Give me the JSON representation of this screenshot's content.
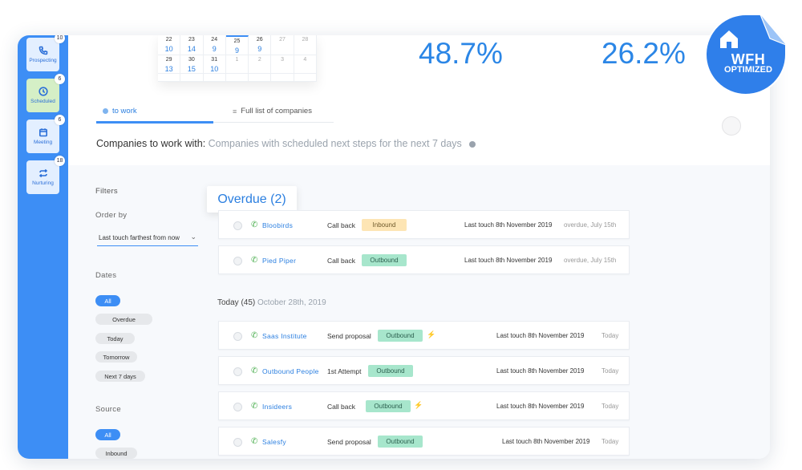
{
  "sidebar": {
    "items": [
      {
        "label": "Prospecting",
        "count": "10",
        "icon": "phone-icon"
      },
      {
        "label": "Scheduled",
        "count": "6",
        "icon": "clock-icon"
      },
      {
        "label": "Meeting",
        "count": "6",
        "icon": "calendar-icon"
      },
      {
        "label": "Nurturing",
        "count": "18",
        "icon": "repeat-icon"
      }
    ]
  },
  "calendar": {
    "rows": [
      [
        {
          "day": "22",
          "count": "10"
        },
        {
          "day": "23",
          "count": "14"
        },
        {
          "day": "24",
          "count": "9"
        },
        {
          "day": "25",
          "count": "9"
        },
        {
          "day": "26",
          "count": "9"
        },
        {
          "day": "27",
          "count": ""
        },
        {
          "day": "28",
          "count": ""
        }
      ],
      [
        {
          "day": "29",
          "count": "13"
        },
        {
          "day": "30",
          "count": "15"
        },
        {
          "day": "31",
          "count": "10"
        },
        {
          "day": "1",
          "count": ""
        },
        {
          "day": "2",
          "count": ""
        },
        {
          "day": "3",
          "count": ""
        },
        {
          "day": "4",
          "count": ""
        }
      ]
    ]
  },
  "metrics": {
    "first": "48.7%",
    "second": "26.2%"
  },
  "tabs": {
    "to_work": "to work",
    "full_list": "Full list of companies"
  },
  "heading": {
    "main": "Companies to work with:",
    "sub": "Companies with scheduled next steps for the next 7 days"
  },
  "filters": {
    "title": "Filters",
    "order_by_label": "Order by",
    "order_by_value": "Last touch farthest from now",
    "dates_label": "Dates",
    "dates": [
      "All",
      "Overdue",
      "Today",
      "Tomorrow",
      "Next 7 days"
    ],
    "source_label": "Source",
    "sources": [
      "All",
      "Inbound"
    ]
  },
  "overdue": {
    "label": "Overdue (2)"
  },
  "today": {
    "label": "Today (45)",
    "date": "October 28th, 2019"
  },
  "tasks": [
    {
      "company": "Bloobirds",
      "action": "Call back",
      "tag": "Inbound",
      "last": "Last touch 8th November 2019",
      "due": "overdue, July 15th"
    },
    {
      "company": "Pied Piper",
      "action": "Call back",
      "tag": "Outbound",
      "last": "Last touch 8th November 2019",
      "due": "overdue, July 15th"
    },
    {
      "company": "Saas Institute",
      "action": "Send proposal",
      "tag": "Outbound",
      "last": "Last touch 8th November 2019",
      "due": "Today"
    },
    {
      "company": "Outbound People",
      "action": "1st Attempt",
      "tag": "Outbound",
      "last": "Last touch 8th November 2019",
      "due": "Today"
    },
    {
      "company": "Insideers",
      "action": "Call back",
      "tag": "Outbound",
      "last": "Last touch 8th November 2019",
      "due": "Today"
    },
    {
      "company": "Salesfy",
      "action": "Send proposal",
      "tag": "Outbound",
      "last": "Last touch 8th November 2019",
      "due": "Today"
    }
  ],
  "badge": {
    "line1": "WFH",
    "line2": "OPTIMIZED",
    "icon": "home-icon"
  },
  "colors": {
    "accent": "#3d8ef5",
    "inbound": "#fde5b4",
    "outbound": "#a7e6cc",
    "badge": "#2f7fea"
  }
}
